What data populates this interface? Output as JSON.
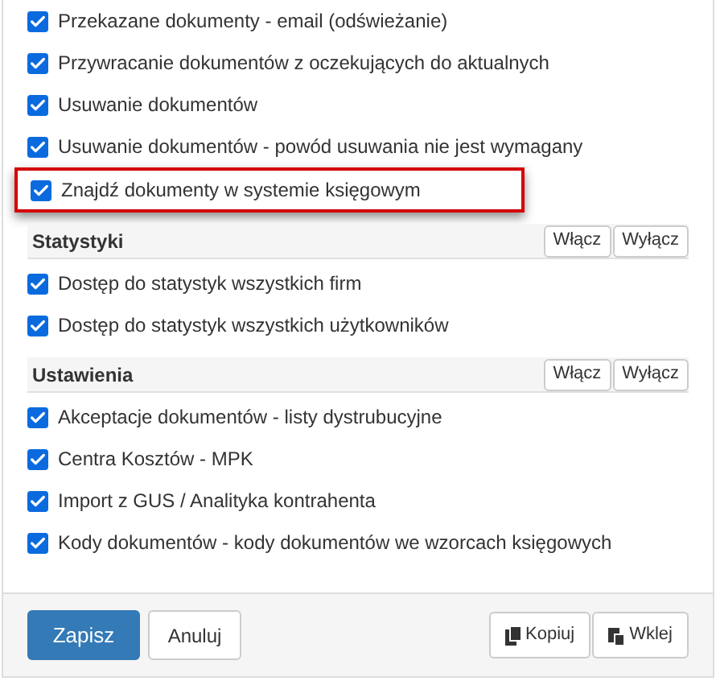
{
  "groups": [
    {
      "items": [
        {
          "label": "Przekazane dokumenty - email (odświeżanie)",
          "checked": true,
          "highlighted": false
        },
        {
          "label": "Przywracanie dokumentów z oczekujących do aktualnych",
          "checked": true,
          "highlighted": false
        },
        {
          "label": "Usuwanie dokumentów",
          "checked": true,
          "highlighted": false
        },
        {
          "label": "Usuwanie dokumentów - powód usuwania nie jest wymagany",
          "checked": true,
          "highlighted": false
        },
        {
          "label": "Znajdź dokumenty w systemie księgowym",
          "checked": true,
          "highlighted": true
        }
      ]
    },
    {
      "title": "Statystyki",
      "on_button": "Włącz",
      "off_button": "Wyłącz",
      "items": [
        {
          "label": "Dostęp do statystyk wszystkich firm",
          "checked": true,
          "highlighted": false
        },
        {
          "label": "Dostęp do statystyk wszystkich użytkowników",
          "checked": true,
          "highlighted": false
        }
      ]
    },
    {
      "title": "Ustawienia",
      "on_button": "Włącz",
      "off_button": "Wyłącz",
      "items": [
        {
          "label": "Akceptacje dokumentów - listy dystrubucyjne",
          "checked": true,
          "highlighted": false
        },
        {
          "label": "Centra Kosztów - MPK",
          "checked": true,
          "highlighted": false
        },
        {
          "label": "Import z GUS / Analityka kontrahenta",
          "checked": true,
          "highlighted": false
        },
        {
          "label": "Kody dokumentów - kody dokumentów we wzorcach księgowych",
          "checked": true,
          "highlighted": false
        }
      ]
    }
  ],
  "footer": {
    "save": "Zapisz",
    "cancel": "Anuluj",
    "copy": "Kopiuj",
    "paste": "Wklej"
  }
}
